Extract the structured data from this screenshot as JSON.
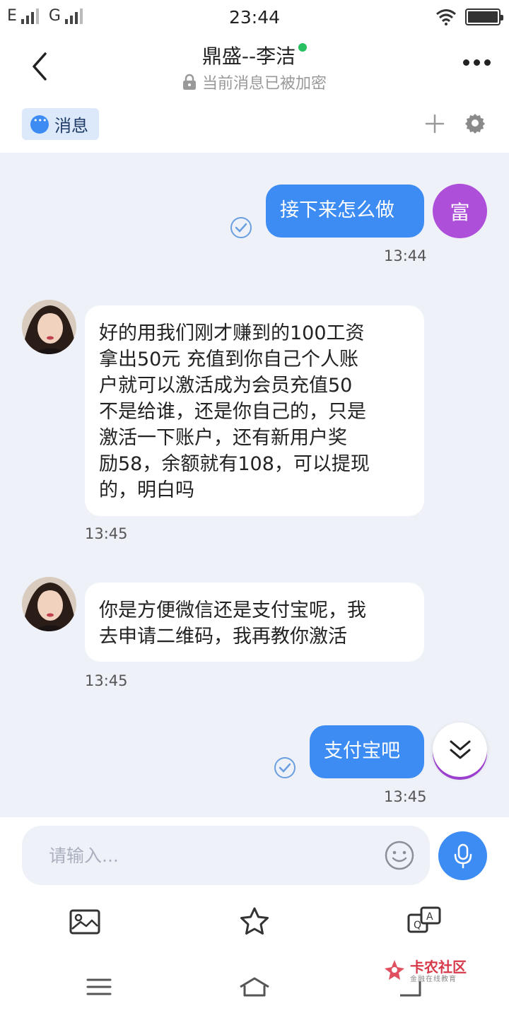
{
  "status_bar": {
    "net1": "E",
    "net2": "G",
    "time": "23:44"
  },
  "header": {
    "title": "鼎盛--李洁",
    "subtitle": "当前消息已被加密"
  },
  "tabs": {
    "message_label": "消息"
  },
  "chat": {
    "my_avatar_text": "富",
    "messages": [
      {
        "from": "me",
        "text": "接下来怎么做",
        "time": "13:44",
        "read": true
      },
      {
        "from": "her",
        "lines": [
          "好的用我们刚才赚到的100工资",
          "拿出50元 充值到你自己个人账",
          "户就可以激活成为会员充值50",
          "不是给谁，还是你自己的，只是",
          "激活一下账户，还有新用户奖",
          "励58，余额就有108，可以提现",
          "的，明白吗"
        ],
        "time": "13:45"
      },
      {
        "from": "her",
        "lines": [
          "你是方便微信还是支付宝呢，我",
          "去申请二维码，我再教你激活"
        ],
        "time": "13:45"
      },
      {
        "from": "me",
        "text": "支付宝吧",
        "time": "13:45",
        "read": true
      }
    ]
  },
  "input": {
    "placeholder": "请输入..."
  },
  "watermark": {
    "main": "卡农社区",
    "sub": "金融在线教育"
  },
  "colors": {
    "accent": "#3d8cf3",
    "avatar": "#ad4fd9",
    "chat_bg": "#eef1f8",
    "online": "#27c060"
  }
}
